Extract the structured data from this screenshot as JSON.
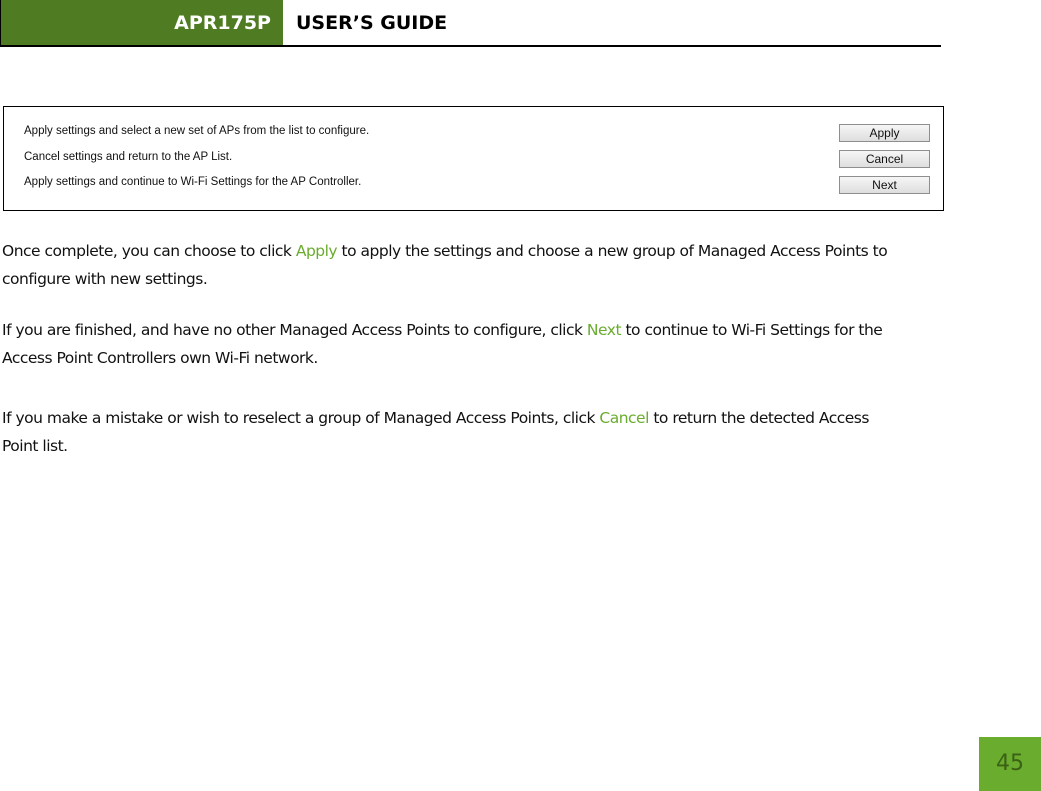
{
  "header": {
    "product": "APR175P",
    "title": "USER’S GUIDE",
    "brand_color": "#4f7c22"
  },
  "screenshot_panel": {
    "rows": [
      {
        "description": "Apply settings and select a new set of APs from the list to configure.",
        "button": "Apply"
      },
      {
        "description": "Cancel settings and return to the AP List.",
        "button": "Cancel"
      },
      {
        "description": "Apply settings and continue to Wi-Fi Settings for the AP Controller.",
        "button": "Next"
      }
    ]
  },
  "body": {
    "highlight_color": "#6aac2e",
    "paragraphs": [
      {
        "before": "Once complete, you can choose to click ",
        "highlight": "Apply",
        "after": " to apply the settings and choose a new group of Managed Access Points to configure with new settings."
      },
      {
        "before": "If you are finished, and have no other Managed Access Points to configure, click ",
        "highlight": "Next",
        "after": " to continue to Wi-Fi Settings for the Access Point Controllers own Wi-Fi network."
      },
      {
        "before": "If you make a mistake or wish to reselect a group of Managed Access Points, click ",
        "highlight": "Cancel",
        "after": " to return the detected Access Point list."
      }
    ]
  },
  "footer": {
    "page_number": "45",
    "badge_color": "#6aac2e"
  }
}
